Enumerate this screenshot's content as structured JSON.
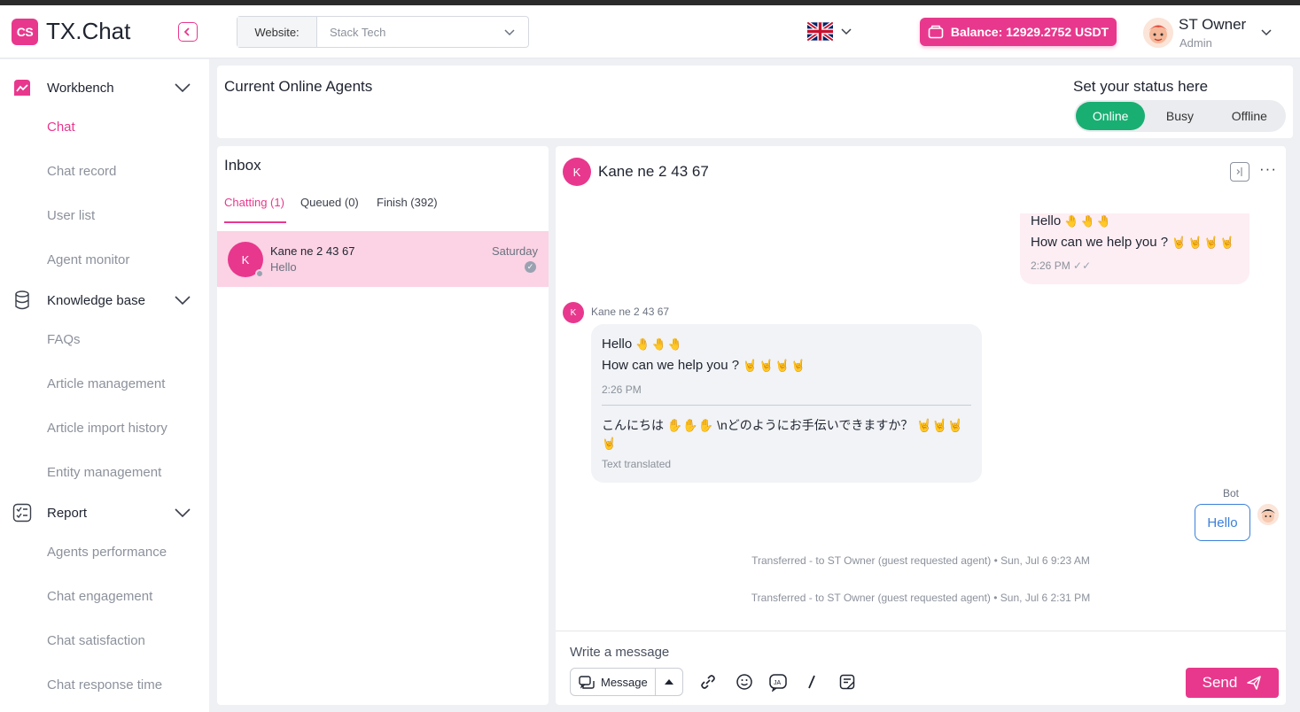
{
  "header": {
    "logo_text": "CS",
    "app_title": "TX.Chat",
    "website_label": "Website:",
    "website_value": "Stack Tech",
    "balance": "Balance: 12929.2752 USDT",
    "user_name": "ST Owner",
    "user_role": "Admin",
    "colors": {
      "accent": "#e8388d",
      "online": "#1aaf72"
    }
  },
  "sidebar": {
    "groups": [
      {
        "label": "Workbench",
        "icon": "workbench-icon",
        "items": [
          "Chat",
          "Chat record",
          "User list",
          "Agent monitor"
        ]
      },
      {
        "label": "Knowledge base",
        "icon": "database-icon",
        "items": [
          "FAQs",
          "Article management",
          "Article import history",
          "Entity management"
        ]
      },
      {
        "label": "Report",
        "icon": "checklist-icon",
        "items": [
          "Agents performance",
          "Chat engagement",
          "Chat satisfaction",
          "Chat response time"
        ]
      }
    ],
    "active_item": "Chat"
  },
  "agents": {
    "title": "Current Online Agents",
    "status_title": "Set your status here",
    "statuses": [
      "Online",
      "Busy",
      "Offline"
    ],
    "selected_status": "Online"
  },
  "inbox": {
    "title": "Inbox",
    "tabs": [
      "Chatting (1)",
      "Queued (0)",
      "Finish (392)"
    ],
    "conversation": {
      "avatar": "K",
      "name": "Kane ne 2 43 67",
      "preview": "Hello",
      "time": "Saturday"
    }
  },
  "chat": {
    "avatar": "K",
    "name": "Kane ne 2 43 67",
    "outgoing": {
      "line1": "Hello",
      "line1_emoji": "🤚🤚🤚",
      "line2": "How can we help you ?",
      "line2_emoji": "🤘🤘🤘🤘",
      "time": "2:26 PM"
    },
    "incoming": {
      "sender": "Kane ne 2 43 67",
      "line1": "Hello",
      "line1_emoji": "🤚🤚🤚",
      "line2": "How can we help you ?",
      "line2_emoji": "🤘🤘🤘🤘",
      "time": "2:26 PM",
      "translation_line1": "こんにちは ✋✋✋ \\nどのようにお手伝いできますか？ 🤘🤘🤘",
      "translation_line2": "🤘",
      "translated_label": "Text translated"
    },
    "bot": {
      "label": "Bot",
      "message": "Hello"
    },
    "system": [
      "Transferred - to ST Owner  (guest requested agent) • Sun, Jul 6 9:23 AM",
      "Transferred - to ST Owner  (guest requested agent) • Sun, Jul 6 2:31 PM"
    ],
    "composer": {
      "placeholder": "Write a message",
      "mode": "Message",
      "send": "Send"
    }
  }
}
